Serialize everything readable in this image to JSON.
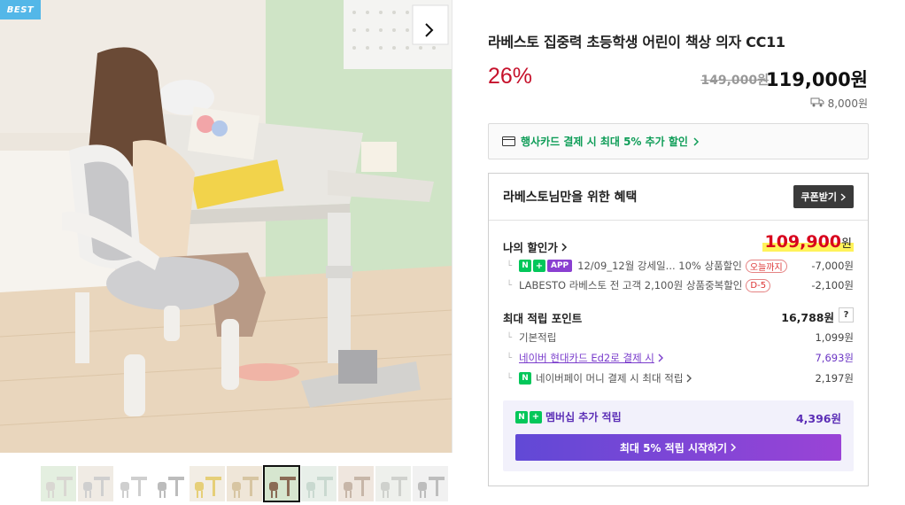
{
  "gallery": {
    "badge": "BEST",
    "main_image_icon": "product-photo-girl-at-desk",
    "thumbnails": [
      {
        "icon": "thumb-desk-chair-set"
      },
      {
        "icon": "thumb-desk-room"
      },
      {
        "icon": "thumb-chair-white"
      },
      {
        "icon": "thumb-chair-grey"
      },
      {
        "icon": "thumb-desk-set-beige"
      },
      {
        "icon": "thumb-desk-set-wood"
      },
      {
        "icon": "thumb-girl-at-desk"
      },
      {
        "icon": "thumb-desk-set-mint"
      },
      {
        "icon": "thumb-girl-studying"
      },
      {
        "icon": "thumb-desk-chair-room"
      },
      {
        "icon": "thumb-desk-chair-cut"
      }
    ],
    "active_thumb_index": 6
  },
  "product": {
    "title": "라베스토 집중력 초등학생 어린이 책상 의자 CC11",
    "discount": "26%",
    "original_price": "149,000원",
    "sale_price": "119,000원",
    "shipping_fee": "8,000원"
  },
  "card_promo": {
    "text": "행사카드 결제 시 최대 5% 추가 할인"
  },
  "benefits": {
    "title": "라베스토님만을 위한 혜택",
    "coupon_button": "쿠폰받기",
    "my_price_label": "나의 할인가",
    "my_price": "109,900",
    "won": "원",
    "discounts": [
      {
        "badge_n": "N",
        "badge_plus": "+",
        "badge_app": "APP",
        "text": "12/09_12월 강세일... 10% 상품할인",
        "pill": "오늘까지",
        "amount": "-7,000원"
      },
      {
        "text": "LABESTO 라베스토 전 고객 2,100원 상품중복할인",
        "pill": "D-5",
        "amount": "-2,100원"
      }
    ],
    "points_label": "최대 적립 포인트",
    "points_total": "16,788원",
    "help_button": "?",
    "points": [
      {
        "text": "기본적립",
        "amount": "1,099원"
      },
      {
        "text": "네이버 현대카드 Ed2로 결제 시",
        "amount": "7,693원"
      },
      {
        "badge": "N",
        "text": "네이버페이 머니 결제 시 최대 적립",
        "amount": "2,197원"
      }
    ],
    "membership": {
      "badge_n": "N",
      "badge_plus": "+",
      "label": "멤버십 추가 적립",
      "amount": "4,396원",
      "button": "최대 5% 적립 시작하기"
    }
  },
  "colors": {
    "discount_red": "#c6112b",
    "price_red": "#d8001c",
    "naver_green": "#03c75a",
    "membership_purple": "#6149d6",
    "badge_blue": "#53b7e8"
  }
}
